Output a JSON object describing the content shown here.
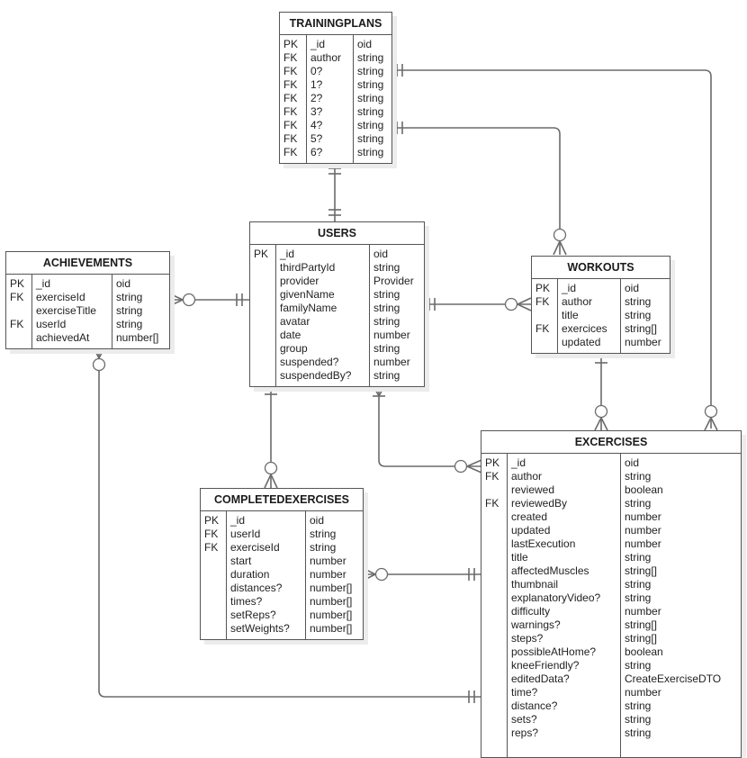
{
  "entities": {
    "trainingplans": {
      "title": "TRAININGPLANS",
      "keys": [
        "PK",
        "FK",
        "FK",
        "FK",
        "FK",
        "FK",
        "FK",
        "FK",
        "FK"
      ],
      "names": [
        "_id",
        "author",
        "0?",
        "1?",
        "2?",
        "3?",
        "4?",
        "5?",
        "6?"
      ],
      "types": [
        "oid",
        "string",
        "string",
        "string",
        "string",
        "string",
        "string",
        "string",
        "string"
      ]
    },
    "users": {
      "title": "USERS",
      "keys": [
        "PK",
        "",
        "",
        "",
        "",
        "",
        "",
        "",
        "",
        ""
      ],
      "names": [
        "_id",
        "thirdPartyId",
        "provider",
        "givenName",
        "familyName",
        "avatar",
        "date",
        "group",
        "suspended?",
        "suspendedBy?"
      ],
      "types": [
        "oid",
        "string",
        "Provider",
        "string",
        "string",
        "string",
        "number",
        "string",
        "number",
        "string"
      ]
    },
    "achievements": {
      "title": "ACHIEVEMENTS",
      "keys": [
        "PK",
        "FK",
        "",
        "FK",
        ""
      ],
      "names": [
        "_id",
        "exerciseId",
        "exerciseTitle",
        "userId",
        "achievedAt"
      ],
      "types": [
        "oid",
        "string",
        "string",
        "string",
        "number[]"
      ]
    },
    "workouts": {
      "title": "WORKOUTS",
      "keys": [
        "PK",
        "FK",
        "",
        "FK",
        ""
      ],
      "names": [
        "_id",
        "author",
        "title",
        "exercices",
        "updated"
      ],
      "types": [
        "oid",
        "string",
        "string",
        "string[]",
        "number"
      ]
    },
    "completedexercises": {
      "title": "COMPLETEDEXERCISES",
      "keys": [
        "PK",
        "FK",
        "FK",
        "",
        "",
        "",
        "",
        "",
        ""
      ],
      "names": [
        "_id",
        "userId",
        "exerciseId",
        "start",
        "duration",
        "distances?",
        "times?",
        "setReps?",
        "setWeights?"
      ],
      "types": [
        "oid",
        "string",
        "string",
        "number",
        "number",
        "number[]",
        "number[]",
        "number[]",
        "number[]"
      ]
    },
    "excercises": {
      "title": "EXCERCISES",
      "keys": [
        "PK",
        "FK",
        "",
        "FK",
        "",
        "",
        "",
        "",
        "",
        "",
        "",
        "",
        "",
        "",
        "",
        "",
        "",
        "",
        "",
        "",
        "",
        ""
      ],
      "names": [
        "_id",
        "author",
        "reviewed",
        "reviewedBy",
        "created",
        "updated",
        "lastExecution",
        "title",
        "affectedMuscles",
        "thumbnail",
        "explanatoryVideo?",
        "difficulty",
        "warnings?",
        "steps?",
        "possibleAtHome?",
        "kneeFriendly?",
        "editedData?",
        "time?",
        "distance?",
        "sets?",
        "reps?"
      ],
      "types": [
        "oid",
        "string",
        "boolean",
        "string",
        "number",
        "number",
        "number",
        "string",
        "string[]",
        "string",
        "string",
        "number",
        "string[]",
        "string[]",
        "boolean",
        "string",
        "CreateExerciseDTO",
        "number",
        "string",
        "string",
        "string"
      ]
    }
  },
  "relationships": [
    {
      "from": "trainingplans",
      "to": "users",
      "from_cardinality": "one-and-only-one",
      "to_cardinality": "one-and-only-one"
    },
    {
      "from": "trainingplans",
      "to": "workouts",
      "from_cardinality": "one-and-only-one",
      "to_cardinality": "zero-or-many"
    },
    {
      "from": "trainingplans",
      "to": "excercises",
      "from_cardinality": "one-and-only-one",
      "to_cardinality": "zero-or-many"
    },
    {
      "from": "users",
      "to": "achievements",
      "from_cardinality": "one-and-only-one",
      "to_cardinality": "zero-or-many"
    },
    {
      "from": "users",
      "to": "workouts",
      "from_cardinality": "one-and-only-one",
      "to_cardinality": "zero-or-many"
    },
    {
      "from": "users",
      "to": "completedexercises",
      "from_cardinality": "one-and-only-one",
      "to_cardinality": "zero-or-many"
    },
    {
      "from": "users",
      "to": "excercises",
      "from_cardinality": "one-or-many",
      "to_cardinality": "zero-or-many"
    },
    {
      "from": "workouts",
      "to": "excercises",
      "from_cardinality": "one-and-only-one",
      "to_cardinality": "zero-or-many"
    },
    {
      "from": "excercises",
      "to": "completedexercises",
      "from_cardinality": "one-and-only-one",
      "to_cardinality": "zero-or-many"
    },
    {
      "from": "excercises",
      "to": "achievements",
      "from_cardinality": "one-and-only-one",
      "to_cardinality": "zero-or-many"
    }
  ]
}
